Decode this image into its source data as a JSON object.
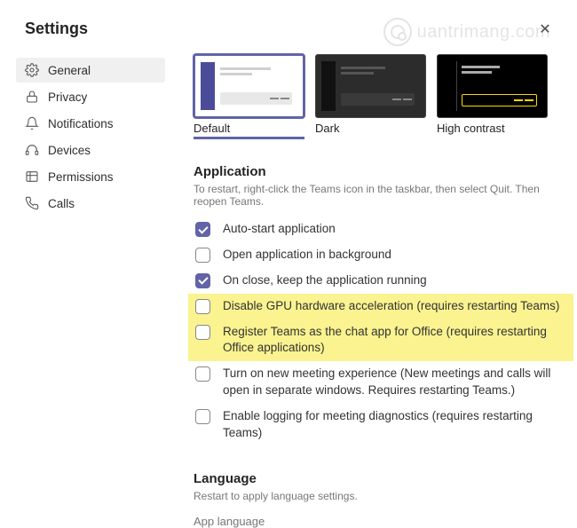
{
  "window": {
    "title": "Settings"
  },
  "sidebar": {
    "items": [
      {
        "label": "General",
        "icon": "gear-icon",
        "active": true
      },
      {
        "label": "Privacy",
        "icon": "lock-icon",
        "active": false
      },
      {
        "label": "Notifications",
        "icon": "bell-icon",
        "active": false
      },
      {
        "label": "Devices",
        "icon": "headset-icon",
        "active": false
      },
      {
        "label": "Permissions",
        "icon": "permissions-icon",
        "active": false
      },
      {
        "label": "Calls",
        "icon": "phone-icon",
        "active": false
      }
    ]
  },
  "themes": {
    "options": [
      {
        "label": "Default",
        "selected": true
      },
      {
        "label": "Dark",
        "selected": false
      },
      {
        "label": "High contrast",
        "selected": false
      }
    ]
  },
  "application": {
    "heading": "Application",
    "subtext": "To restart, right-click the Teams icon in the taskbar, then select Quit. Then reopen Teams.",
    "options": [
      {
        "label": "Auto-start application",
        "checked": true,
        "highlight": false
      },
      {
        "label": "Open application in background",
        "checked": false,
        "highlight": false
      },
      {
        "label": "On close, keep the application running",
        "checked": true,
        "highlight": false
      },
      {
        "label": "Disable GPU hardware acceleration (requires restarting Teams)",
        "checked": false,
        "highlight": true
      },
      {
        "label": "Register Teams as the chat app for Office (requires restarting Office applications)",
        "checked": false,
        "highlight": true
      },
      {
        "label": "Turn on new meeting experience (New meetings and calls will open in separate windows. Requires restarting Teams.)",
        "checked": false,
        "highlight": false
      },
      {
        "label": "Enable logging for meeting diagnostics (requires restarting Teams)",
        "checked": false,
        "highlight": false
      }
    ]
  },
  "language": {
    "heading": "Language",
    "subtext": "Restart to apply language settings.",
    "select_label": "App language"
  },
  "watermark": {
    "text": "uantrimang.com"
  }
}
